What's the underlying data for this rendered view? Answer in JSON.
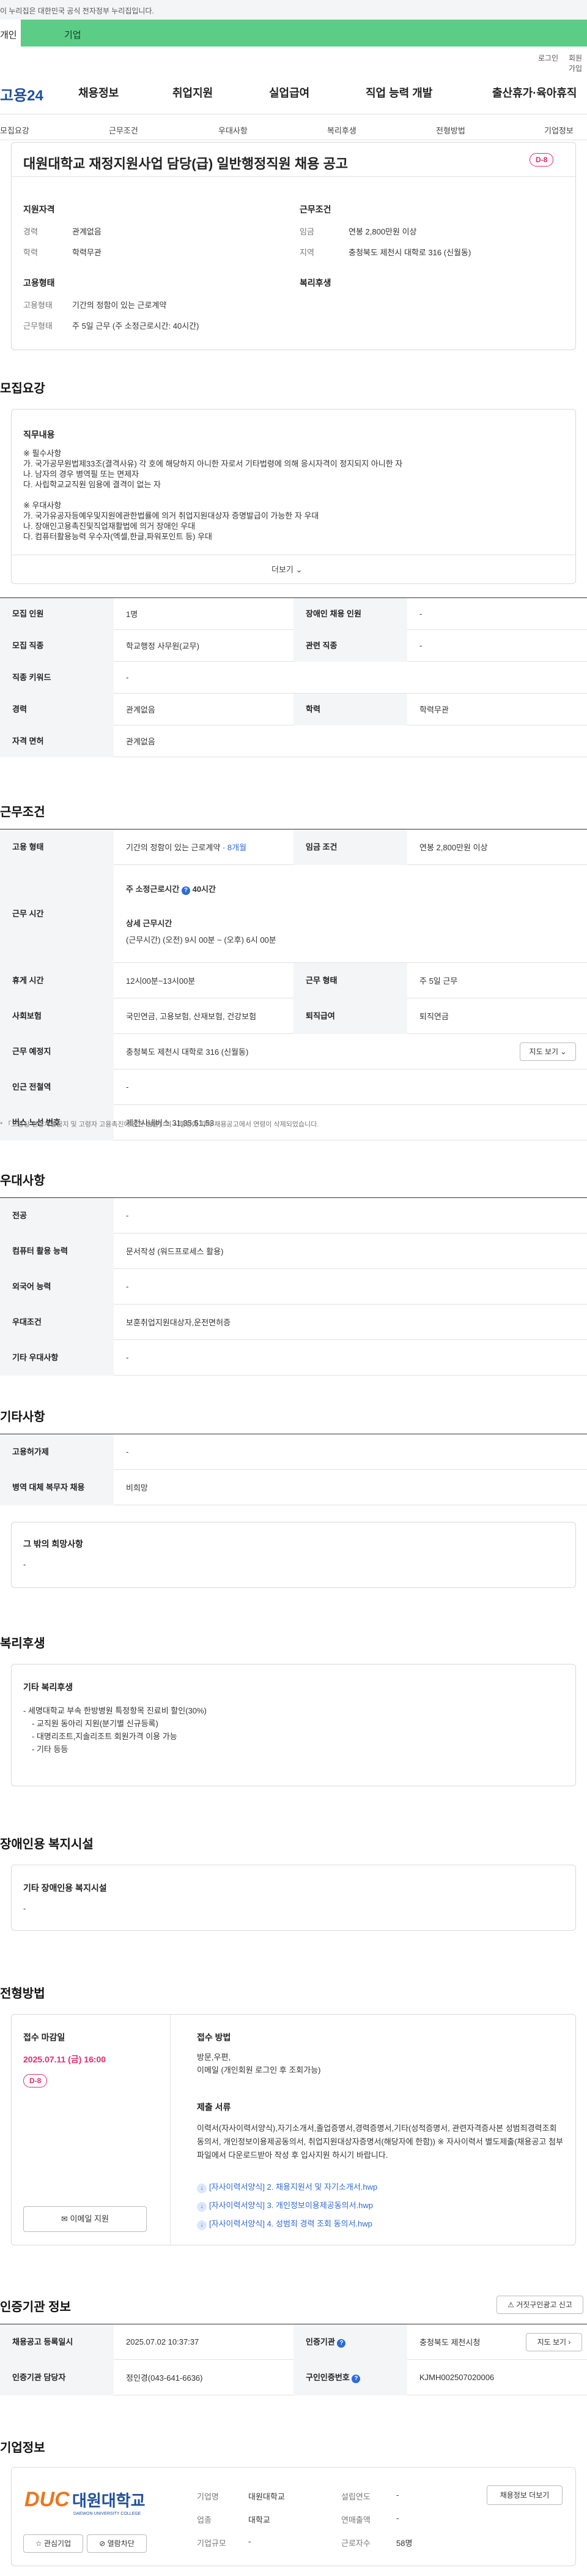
{
  "topbar": {
    "text": "이 누리집은 대한민국 공식 전자정부 누리집입니다."
  },
  "tabs": [
    {
      "label": "개인"
    },
    {
      "label": "기업"
    }
  ],
  "util": {
    "login": "로그인",
    "join": "회원가입"
  },
  "logo": {
    "text": "고용24"
  },
  "gnb": [
    "채용정보",
    "취업지원",
    "실업급여",
    "직업 능력 개발",
    "출산휴가·육아휴직"
  ],
  "lnb": [
    "모집요강",
    "근무조건",
    "우대사항",
    "복리후생",
    "전형방법",
    "기업정보"
  ],
  "title": {
    "text": "대원대학교 재정지원사업 담당(급) 일반행정직원 채용 공고",
    "dday": "D-8"
  },
  "summary": {
    "qual_title": "지원자격",
    "career_label": "경력",
    "career": "관계없음",
    "edu_label": "학력",
    "edu": "학력무관",
    "cond_title": "근무조건",
    "wage_label": "임금",
    "wage": "연봉 2,800만원 이상",
    "region_label": "지역",
    "region": "충청북도 제천시 대학로 316 (신월동)",
    "emp_title": "고용형태",
    "emptype_label": "고용형태",
    "emptype": "기간의 정함이 있는 근로계약",
    "worktype_label": "근무형태",
    "worktype": "주 5일 근무 (주 소정근로시간: 40시간)",
    "welfare_title": "복리후생"
  },
  "recruit": {
    "section": "모집요강",
    "duty_title": "직무내용",
    "duty_lines": [
      "※ 필수사항",
      "가. 국가공무원법제33조(결격사유) 각 호에 해당하지 아니한 자로서 기타법령에 의해 응시자격이 정지되지 아니한 자",
      "나. 남자의 경우 병역필 또는 면제자",
      "다. 사립학교교직원 임용에 결격이 없는 자",
      "",
      "※ 우대사항",
      "가. 국가유공자등예우및지원에관한법률에 의거 취업지원대상자 증명발급이 가능한 자 우대",
      "나. 장애인고용촉진및직업재활법에 의거 장애인 우대",
      "다. 컴퓨터활용능력 우수자(엑셀,한글,파워포인트 등) 우대"
    ],
    "more": "더보기",
    "rows": [
      {
        "k1": "모집 인원",
        "v1": "1명",
        "k2": "장애인 채용 인원",
        "v2": "-"
      },
      {
        "k1": "모집 직종",
        "v1": "학교행정 사무원(교무)",
        "k2": "관련 직종",
        "v2": "-"
      },
      {
        "k1": "직종 키워드",
        "v1": "-"
      },
      {
        "k1": "경력",
        "v1": "관계없음",
        "k2": "학력",
        "v2": "학력무관"
      },
      {
        "k1": "자격 면허",
        "v1": "관계없음"
      }
    ]
  },
  "work": {
    "section": "근무조건",
    "emp_k": "고용 형태",
    "emp_v": "기간의 정함이 있는 근로계약 · ",
    "emp_months": "8개월",
    "wage_k": "임금 조건",
    "wage_v": "연봉 2,800만원 이상",
    "hours_k": "근무 시간",
    "hours_main": "주 소정근로시간",
    "hours_val": "40시간",
    "hours_detail_title": "상세 근무시간",
    "hours_detail": "(근무시간) (오전) 9시 00분 ~ (오후) 6시 00분",
    "break_k": "휴게 시간",
    "break_v": "12시00분~13시00분",
    "form_k": "근무 형태",
    "form_v": "주 5일 근무",
    "ins_k": "사회보험",
    "ins_v": "국민연금, 고용보험, 산재보험, 건강보험",
    "retire_k": "퇴직급여",
    "retire_v": "퇴직연금",
    "place_k": "근무 예정지",
    "place_v": "충청북도 제천시 대학로 316 (신월동)",
    "map_btn": "지도 보기",
    "subway_k": "인근 전철역",
    "subway_v": "-",
    "bus_k": "버스 노선 번호",
    "bus_v": "제천시내버스 31,35,51,53",
    "note": "* 「고용상 연령차별금지 및 고령자 고용촉진에 관한 법률」의 시행령에 따라 채용공고에서 연령이 삭제되었습니다."
  },
  "prefer": {
    "section": "우대사항",
    "rows": [
      {
        "k": "전공",
        "v": "-"
      },
      {
        "k": "컴퓨터 활용 능력",
        "v": "문서작성 (워드프로세스 활용)"
      },
      {
        "k": "외국어 능력",
        "v": "-"
      },
      {
        "k": "우대조건",
        "v": "보훈취업지원대상자,운전면허증"
      },
      {
        "k": "기타 우대사항",
        "v": "-"
      }
    ]
  },
  "etc": {
    "section": "기타사항",
    "rows": [
      {
        "k": "고용허가제",
        "v": "-"
      },
      {
        "k": "병역 대체 복무자 채용",
        "v": "비희망"
      }
    ],
    "hope_title": "그 밖의 희망사항",
    "hope_v": "-"
  },
  "welfare": {
    "section": "복리후생",
    "title": "기타 복리후생",
    "lines": [
      "- 세명대학교 부속 한방병원 특정항목 진료비 할인(30%)",
      "- 교직원 동아리 지원(분기별 신규등록)",
      "- 대명리조트,지솔리조트 회원가격 이용 가능",
      "- 기타 등등"
    ]
  },
  "disabled": {
    "section": "장애인용 복지시설",
    "title": "기타 장애인용 복지시설",
    "v": "-"
  },
  "screening": {
    "section": "전형방법",
    "deadline_title": "접수 마감일",
    "deadline": "2025.07.11 (금) 16:00",
    "dday": "D-8",
    "email_btn": "이메일 지원",
    "method_title": "접수 방법",
    "method_lines": [
      "방문,우편,",
      "이메일 (개인회원 로그인 후 조회가능)"
    ],
    "docs_title": "제출 서류",
    "docs_text": "이력서(자사이력서양식),자기소개서,졸업증명서,경력증명서,기타(성적증명서, 관련자격증사본 성범죄경력조회동의서, 개인정보이용제공동의서, 취업지원대상자증명서(해당자에 한함)) ※ 자사이력서 별도제출(채용공고 첨부파일에서 다운로드받아 작성 후 입사지원 하시기 바랍니다.",
    "files": [
      "[자사이력서양식] 2. 채용지원서 및 자기소개서.hwp",
      "[자사이력서양식] 3. 개인정보이용제공동의서.hwp",
      "[자사이력서양식] 4. 성범죄 경력 조회 동의서.hwp"
    ]
  },
  "agency": {
    "section": "인증기관 정보",
    "report_btn": "거짓구인광고 신고",
    "reg_k": "채용공고 등록일시",
    "reg_v": "2025.07.02 10:37:37",
    "inst_k": "인증기관",
    "inst_v": "충청북도 제천시청",
    "map_btn": "지도 보기",
    "mgr_k": "인증기관 담당자",
    "mgr_v": "정인경(043-641-6636)",
    "num_k": "구인인증번호",
    "num_v": "KJMH002507020006"
  },
  "company": {
    "section": "기업정보",
    "logo_text": "DUC 대원대학교",
    "logo_sub": "DAEWON UNIVERSITY COLLEGE",
    "fav_btn": "관심기업",
    "block_btn": "열람차단",
    "name_k": "기업명",
    "name_v": "대원대학교",
    "year_k": "설립연도",
    "year_v": "-",
    "biz_k": "업종",
    "biz_v": "대학교",
    "sales_k": "연매출액",
    "sales_v": "-",
    "size_k": "기업규모",
    "size_v": "-",
    "emp_k": "근로자수",
    "emp_v": "58명",
    "list_btn": "채용정보 더보기"
  },
  "colors": {
    "accent": "#5ccd86",
    "dday": "#e32b6e",
    "link": "#2f6ad9",
    "navy": "#1f4f9c"
  }
}
